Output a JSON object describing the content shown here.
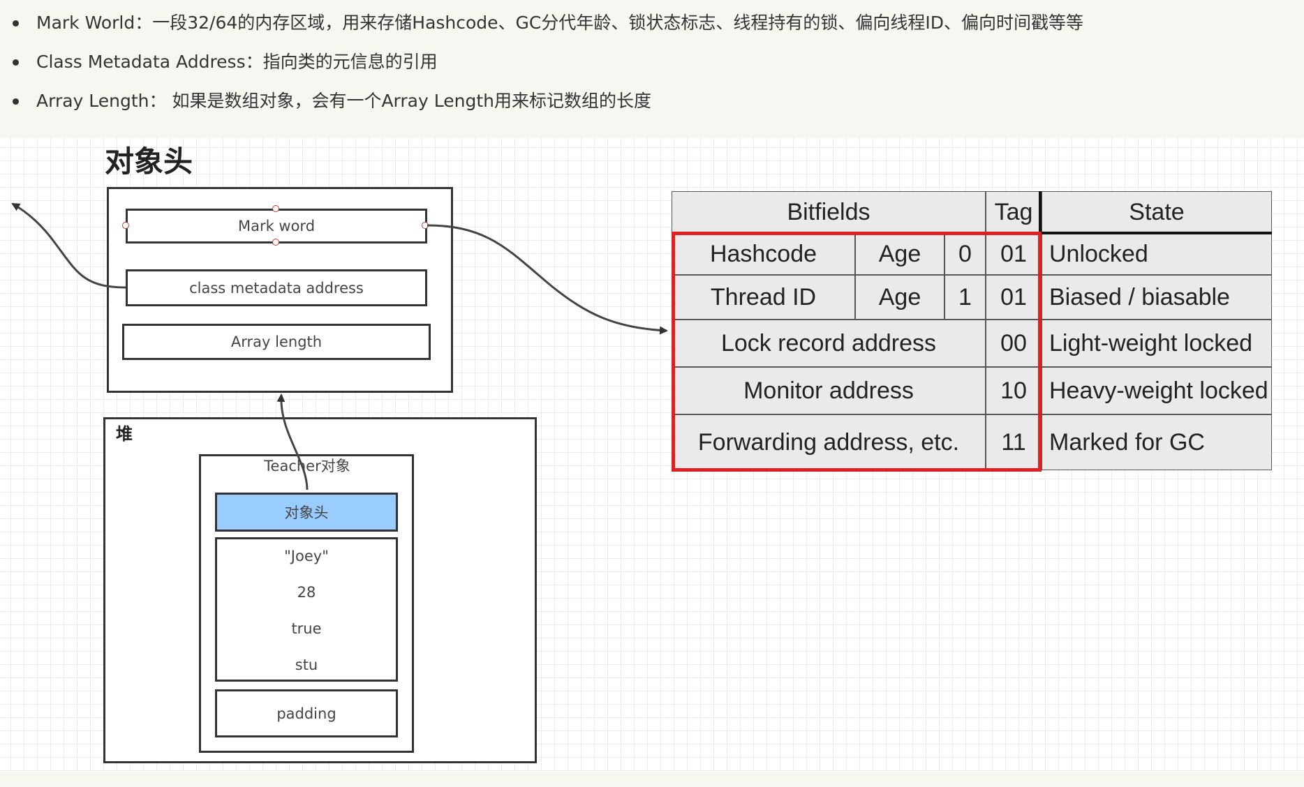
{
  "bullets": [
    {
      "text": "Mark World：一段32/64的内存区域，用来存储Hashcode、GC分代年龄、锁状态标志、线程持有的锁、偏向线程ID、偏向时间戳等等"
    },
    {
      "text": "Class Metadata Address：指向类的元信息的引用"
    },
    {
      "text": "Array Length：  如果是数组对象，会有一个Array Length用来标记数组的长度"
    }
  ],
  "diagram": {
    "title": "对象头",
    "header_fields": {
      "mark_word": "Mark word",
      "class_metadata": "class metadata address",
      "array_length": "Array length"
    },
    "heap": {
      "label": "堆",
      "object_label": "Teacher对象",
      "object_header": "对象头",
      "values": [
        "\"Joey\"",
        "28",
        "true",
        "stu"
      ],
      "padding": "padding"
    }
  },
  "bitfield_table": {
    "headers": {
      "bitfields": "Bitfields",
      "tag": "Tag",
      "state": "State"
    },
    "rows": [
      {
        "cells": [
          "Hashcode",
          "Age",
          "0"
        ],
        "tag": "01",
        "state": "Unlocked"
      },
      {
        "cells": [
          "Thread ID",
          "Age",
          "1"
        ],
        "tag": "01",
        "state": "Biased / biasable"
      },
      {
        "cells": [
          "Lock record address"
        ],
        "tag": "00",
        "state": "Light-weight locked"
      },
      {
        "cells": [
          "Monitor address"
        ],
        "tag": "10",
        "state": "Heavy-weight locked"
      },
      {
        "cells": [
          "Forwarding address, etc."
        ],
        "tag": "11",
        "state": "Marked for GC"
      }
    ],
    "highlight_color": "#e02020"
  },
  "colors": {
    "object_header_fill": "#99ccff",
    "cell_fill": "#eaeaea",
    "page_bg": "#f8f6f1"
  }
}
